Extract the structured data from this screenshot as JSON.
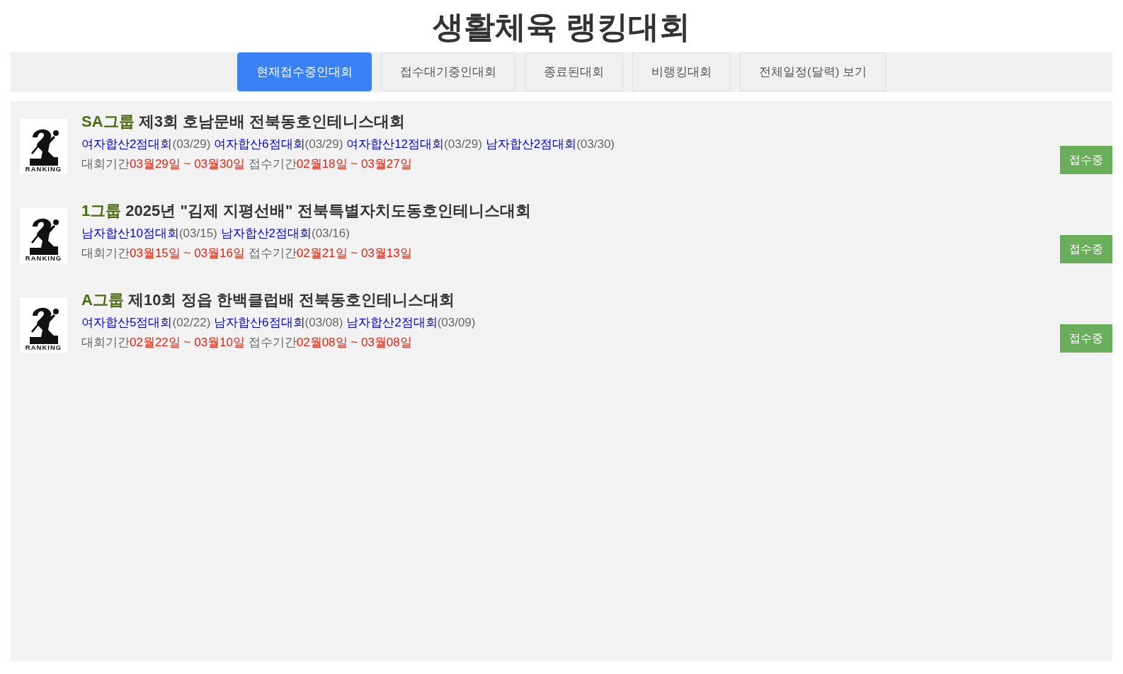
{
  "page_title": "생활체육 랭킹대회",
  "tabs": [
    {
      "label": "현재접수중인대회",
      "selected": true
    },
    {
      "label": "접수대기중인대회",
      "selected": false
    },
    {
      "label": "종료된대회",
      "selected": false
    },
    {
      "label": "비랭킹대회",
      "selected": false
    },
    {
      "label": "전체일정(달력) 보기",
      "selected": false
    }
  ],
  "tournaments": [
    {
      "logo_text": "RANKING",
      "group": "SA그룹",
      "title": "제3회 호남문배 전북동호인테니스대회",
      "events": [
        {
          "name": "여자합산2점대회",
          "date": "(03/29)"
        },
        {
          "name": "여자합산6점대회",
          "date": "(03/29)"
        },
        {
          "name": "여자합산12점대회",
          "date": "(03/29)"
        },
        {
          "name": "남자합산2점대회",
          "date": "(03/30)"
        }
      ],
      "period_label": "대회기간",
      "period": "03월29일 ~ 03월30일",
      "signup_label": "접수기간",
      "signup": "02월18일 ~ 03월27일",
      "status": "접수중"
    },
    {
      "logo_text": "RANKING",
      "group": "1그룹",
      "title": "2025년 \"김제 지평선배\" 전북특별자치도동호인테니스대회",
      "events": [
        {
          "name": "남자합산10점대회",
          "date": "(03/15)"
        },
        {
          "name": "남자합산2점대회",
          "date": "(03/16)"
        }
      ],
      "period_label": "대회기간",
      "period": "03월15일 ~ 03월16일",
      "signup_label": "접수기간",
      "signup": "02월21일 ~ 03월13일",
      "status": "접수중"
    },
    {
      "logo_text": "RANKING",
      "group": "A그룹",
      "title": "제10회 정읍 한백클럽배 전북동호인테니스대회",
      "events": [
        {
          "name": "여자합산5점대회",
          "date": "(02/22)"
        },
        {
          "name": "남자합산6점대회",
          "date": "(03/08)"
        },
        {
          "name": "남자합산2점대회",
          "date": "(03/09)"
        }
      ],
      "period_label": "대회기간",
      "period": "02월22일 ~ 03월10일",
      "signup_label": "접수기간",
      "signup": "02월08일 ~ 03월08일",
      "status": "접수중"
    }
  ]
}
